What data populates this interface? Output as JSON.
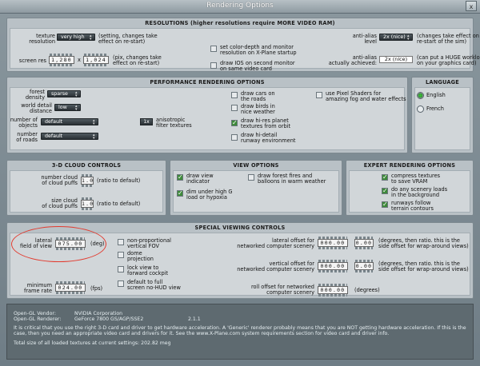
{
  "window": {
    "title": "Rendering Options",
    "close_label": "x"
  },
  "resolutions": {
    "title": "RESOLUTIONS (higher resolutions require MORE VIDEO RAM)",
    "texture_label": "texture\nresolution",
    "texture_value": "very high",
    "texture_note": "(setting, changes take\neffect on re-start)",
    "screen_res_label": "screen res",
    "width": "1,280",
    "height": "1,024",
    "x_label": "x",
    "screen_res_note": "(pix, changes take\neffect on re-start)",
    "color_depth_label": "set color-depth and monitor\nresolution on X-Plane startup",
    "draw_ios_label": "draw IOS on second monitor\non same video card",
    "antialias_label": "anti-alias\nlevel",
    "antialias_value": "2x (nice)",
    "antialias_note": "(changes take effect on\nre-start of the sim)",
    "antialias_achieved_label": "anti-alias\nactually achieved:",
    "antialias_achieved_value": "2x (nice)",
    "antialias_achieved_note": "(can put a HUGE workload\non your graphics card)"
  },
  "performance": {
    "title": "PERFORMANCE RENDERING OPTIONS",
    "forest_label": "forest\ndensity",
    "forest_value": "sparse",
    "world_detail_label": "world detail\ndistance",
    "world_detail_value": "low",
    "objects_label": "number of\nobjects",
    "objects_value": "default",
    "roads_label": "number\nof roads",
    "roads_value": "default",
    "aniso_value": "1x",
    "aniso_label": "anisotropic\nfilter textures",
    "cars_label": "draw cars on\nthe roads",
    "birds_label": "draw birds in\nnice weather",
    "hires_label": "draw hi-res planet\ntextures from orbit",
    "runway_label": "draw hi-detail\nrunway environment",
    "pixel_shaders_label": "use Pixel Shaders for\namazing fog and water effects"
  },
  "language": {
    "title": "LANGUAGE",
    "english": "English",
    "french": "French"
  },
  "cloud": {
    "title": "3-D CLOUD CONTROLS",
    "num_puffs_label": "number cloud\nof cloud puffs",
    "num_puffs_value": "1.0",
    "num_puffs_note": "(ratio to default)",
    "size_puffs_label": "size cloud\nof cloud puffs",
    "size_puffs_value": "1.0",
    "size_puffs_note": "(ratio to default)"
  },
  "view": {
    "title": "VIEW OPTIONS",
    "draw_view_label": "draw view\nindicator",
    "dim_label": "dim under high G\nload or hypoxia",
    "forest_fires_label": "draw forest fires and\nballoons in warm weather"
  },
  "expert": {
    "title": "EXPERT RENDERING OPTIONS",
    "compress_label": "compress textures\nto save VRAM",
    "scenery_label": "do any scenery loads\nin the background",
    "runways_label": "runways follow\nterrain contours"
  },
  "special": {
    "title": "SPECIAL VIEWING CONTROLS",
    "fov_label": "lateral\nfield of view",
    "fov_value": "075.00",
    "fov_unit": "(deg)",
    "frame_rate_label": "minimum\nframe rate",
    "frame_rate_value": "024.00",
    "frame_rate_unit": "(fps)",
    "nonprop_label": "non-proportional\nvertical FOV",
    "dome_label": "dome\nprojection",
    "lock_label": "lock view to\nforward cockpit",
    "full_screen_label": "default to full\nscreen no-HUD view",
    "lat_offset_label": "lateral offset for\nnetworked computer scenery",
    "lat_offset_value": "000.00",
    "lat_ratio_value": "0.00",
    "lat_offset_note": "(degrees, then ratio. this is the\nside offset for wrap-around views)",
    "vert_offset_label": "vertical offset for\nnetworked computer scenery",
    "vert_offset_value": "000.00",
    "vert_ratio_value": "0.00",
    "vert_offset_note": "(degrees, then ratio. this is the\nside offset for wrap-around views)",
    "roll_offset_label": "roll offset for networked\ncomputer scenery",
    "roll_offset_value": "000.00",
    "roll_offset_unit": "(degrees)"
  },
  "info": {
    "vendor_label": "Open-GL Vendor:",
    "vendor_value": "NVIDIA Corporation",
    "renderer_label": "Open-GL Renderer:",
    "renderer_value": "GeForce 7800 GS/AGP/SSE2",
    "version_value": "2.1.1",
    "warning": "It is critical that you use the right 3-D card and driver to get hardware acceleration. A 'Generic' renderer probably means that you are NOT getting hardware acceleration. If this is the case, then you need an appropriate video card and drivers for it. See the www.X-Plane.com system requirements section for video card and driver info.",
    "textures": "Total size of all loaded textures at current settings: 202.82 meg"
  }
}
